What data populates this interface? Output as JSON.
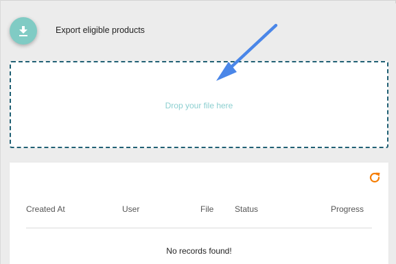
{
  "export": {
    "label": "Export eligible products",
    "icon": "download-icon",
    "fab_color": "#80cbc4"
  },
  "dropzone": {
    "text": "Drop your file here",
    "border_color": "#1f5f73",
    "text_color": "#8ccfd0"
  },
  "annotation": {
    "arrow_color": "#4a86e8"
  },
  "table": {
    "refresh_icon": "refresh-icon",
    "refresh_color": "#f57c00",
    "columns": [
      "Created At",
      "User",
      "File",
      "Status",
      "Progress"
    ],
    "empty_message": "No records found!"
  }
}
